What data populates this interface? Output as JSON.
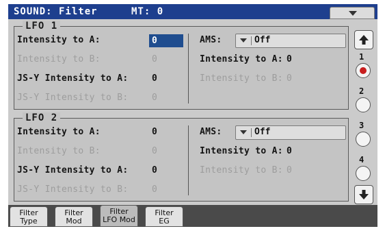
{
  "title": {
    "section": "SOUND: Filter",
    "mt_label": "MT: 0"
  },
  "page_menu": {
    "icon": "triangle-down-icon"
  },
  "lfo1": {
    "legend": "LFO 1",
    "intensity_a_label": "Intensity to A:",
    "intensity_a_value": "0",
    "intensity_b_label": "Intensity to B:",
    "intensity_b_value": "0",
    "jsy_a_label": "JS-Y Intensity to A:",
    "jsy_a_value": "0",
    "jsy_b_label": "JS-Y Intensity to B:",
    "jsy_b_value": "0",
    "ams_label": "AMS:",
    "ams_value": "Off",
    "ams_intensity_a_label": "Intensity to A:",
    "ams_intensity_a_value": "0",
    "ams_intensity_b_label": "Intensity to B:",
    "ams_intensity_b_value": "0"
  },
  "lfo2": {
    "legend": "LFO 2",
    "intensity_a_label": "Intensity to A:",
    "intensity_a_value": "0",
    "intensity_b_label": "Intensity to B:",
    "intensity_b_value": "0",
    "jsy_a_label": "JS-Y Intensity to A:",
    "jsy_a_value": "0",
    "jsy_b_label": "JS-Y Intensity to B:",
    "jsy_b_value": "0",
    "ams_label": "AMS:",
    "ams_value": "Off",
    "ams_intensity_a_label": "Intensity to A:",
    "ams_intensity_a_value": "0",
    "ams_intensity_b_label": "Intensity to B:",
    "ams_intensity_b_value": "0"
  },
  "sidebar": {
    "up_icon": "arrow-up-icon",
    "down_icon": "arrow-down-icon",
    "channels": [
      "1",
      "2",
      "3",
      "4"
    ],
    "selected_channel": "1",
    "selected_color": "#c81e1e"
  },
  "tabs": [
    {
      "line1": "Filter",
      "line2": "Type"
    },
    {
      "line1": "Filter",
      "line2": "Mod"
    },
    {
      "line1": "Filter",
      "line2": "LFO Mod"
    },
    {
      "line1": "Filter",
      "line2": "EG"
    }
  ],
  "active_tab": "Filter LFO Mod",
  "colors": {
    "title_bar": "#1e3f8e",
    "selected_field": "#1f4d8f",
    "frame": "#4a4a4a"
  }
}
